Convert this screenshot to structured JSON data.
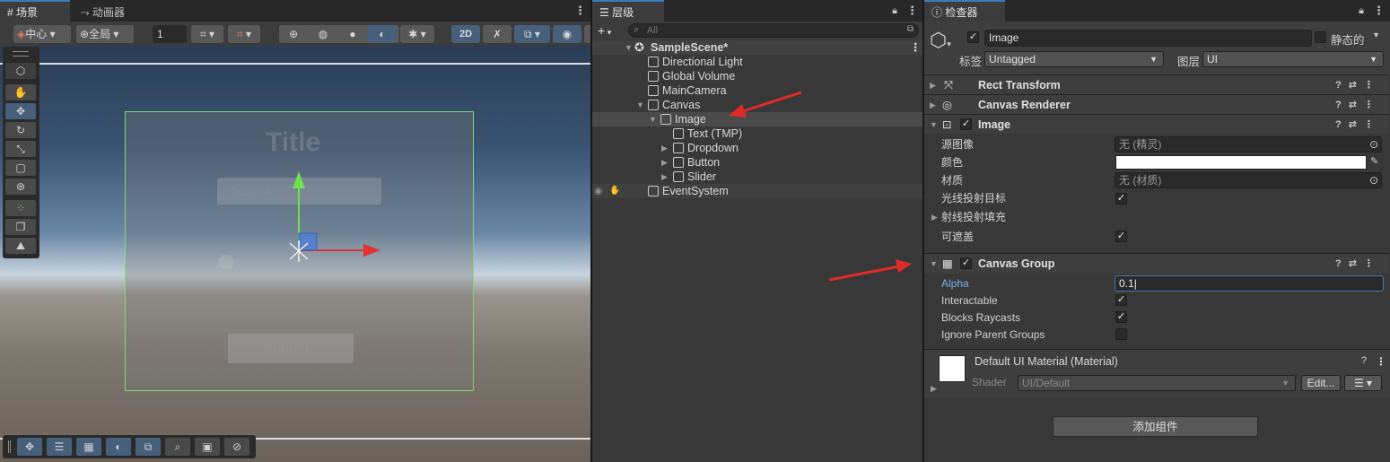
{
  "scene_panel": {
    "tabs": [
      {
        "label": "场景"
      },
      {
        "label": "动画器"
      }
    ],
    "toolbar": {
      "pivot_label": "中心",
      "space_label": "全局",
      "increment_value": "1",
      "mode_2d_label": "2D"
    },
    "canvas_preview": {
      "title_text": "Title",
      "dropdown_text": "Option A",
      "button_text": "Submit"
    }
  },
  "hierarchy_panel": {
    "tab_label": "层级",
    "search_placeholder": "All",
    "items": [
      {
        "label": "SampleScene*"
      },
      {
        "label": "Directional Light"
      },
      {
        "label": "Global Volume"
      },
      {
        "label": "MainCamera"
      },
      {
        "label": "Canvas"
      },
      {
        "label": "Image"
      },
      {
        "label": "Text (TMP)"
      },
      {
        "label": "Dropdown"
      },
      {
        "label": "Button"
      },
      {
        "label": "Slider"
      },
      {
        "label": "EventSystem"
      }
    ]
  },
  "inspector_panel": {
    "tab_label": "检查器",
    "object_name": "Image",
    "static_label": "静态的",
    "tag_label": "标签",
    "tag_value": "Untagged",
    "layer_label": "图层",
    "layer_value": "UI",
    "components": {
      "rect_transform": "Rect Transform",
      "canvas_renderer": "Canvas Renderer",
      "image": "Image",
      "canvas_group": "Canvas Group"
    },
    "image_fields": {
      "source_image_label": "源图像",
      "source_image_value": "无 (精灵)",
      "color_label": "颜色",
      "material_label": "材质",
      "material_value": "无 (材质)",
      "raycast_target_label": "光线投射目标",
      "raycast_padding_label": "射线投射填充",
      "maskable_label": "可遮盖"
    },
    "canvas_group_fields": {
      "alpha_label": "Alpha",
      "alpha_value": "0.1",
      "interactable_label": "Interactable",
      "blocks_raycasts_label": "Blocks Raycasts",
      "ignore_parent_label": "Ignore Parent Groups"
    },
    "material": {
      "name": "Default UI Material (Material)",
      "shader_label": "Shader",
      "shader_value": "UI/Default",
      "edit_label": "Edit..."
    },
    "add_component_label": "添加组件"
  },
  "colors": {
    "accent": "#3a79bb",
    "arrow_red": "#e02a2a",
    "selection_green": "#7ddc6b"
  }
}
